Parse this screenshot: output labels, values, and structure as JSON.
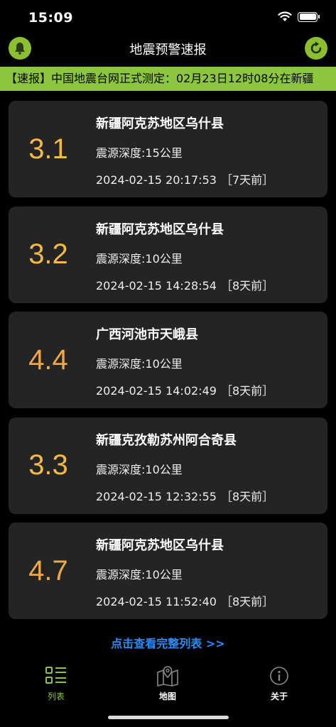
{
  "status_bar": {
    "time": "15:09"
  },
  "nav": {
    "title": "地震预警速报",
    "left_icon": "bell-icon",
    "right_icon": "refresh-icon"
  },
  "ticker": {
    "text": "【速报】中国地震台网正式测定：02月23日12时08分在新疆"
  },
  "quakes": [
    {
      "magnitude": "3.1",
      "location": "新疆阿克苏地区乌什县",
      "depth": "震源深度:15公里",
      "time": "2024-02-15 20:17:53",
      "ago": "［7天前］"
    },
    {
      "magnitude": "3.2",
      "location": "新疆阿克苏地区乌什县",
      "depth": "震源深度:10公里",
      "time": "2024-02-15 14:28:54",
      "ago": "［8天前］"
    },
    {
      "magnitude": "4.4",
      "location": "广西河池市天峨县",
      "depth": "震源深度:10公里",
      "time": "2024-02-15 14:02:49",
      "ago": "［8天前］"
    },
    {
      "magnitude": "3.3",
      "location": "新疆克孜勒苏州阿合奇县",
      "depth": "震源深度:10公里",
      "time": "2024-02-15 12:32:55",
      "ago": "［8天前］"
    },
    {
      "magnitude": "4.7",
      "location": "新疆阿克苏地区乌什县",
      "depth": "震源深度:10公里",
      "time": "2024-02-15 11:52:40",
      "ago": "［8天前］"
    }
  ],
  "more_link": "点击查看完整列表 >>",
  "tabs": [
    {
      "label": "列表",
      "icon": "list-icon"
    },
    {
      "label": "地图",
      "icon": "map-icon"
    },
    {
      "label": "关于",
      "icon": "info-icon"
    }
  ],
  "colors": {
    "accent": "#8cc63f",
    "magnitude": "#f5b942",
    "link": "#2a8cf5",
    "card": "#242424"
  }
}
